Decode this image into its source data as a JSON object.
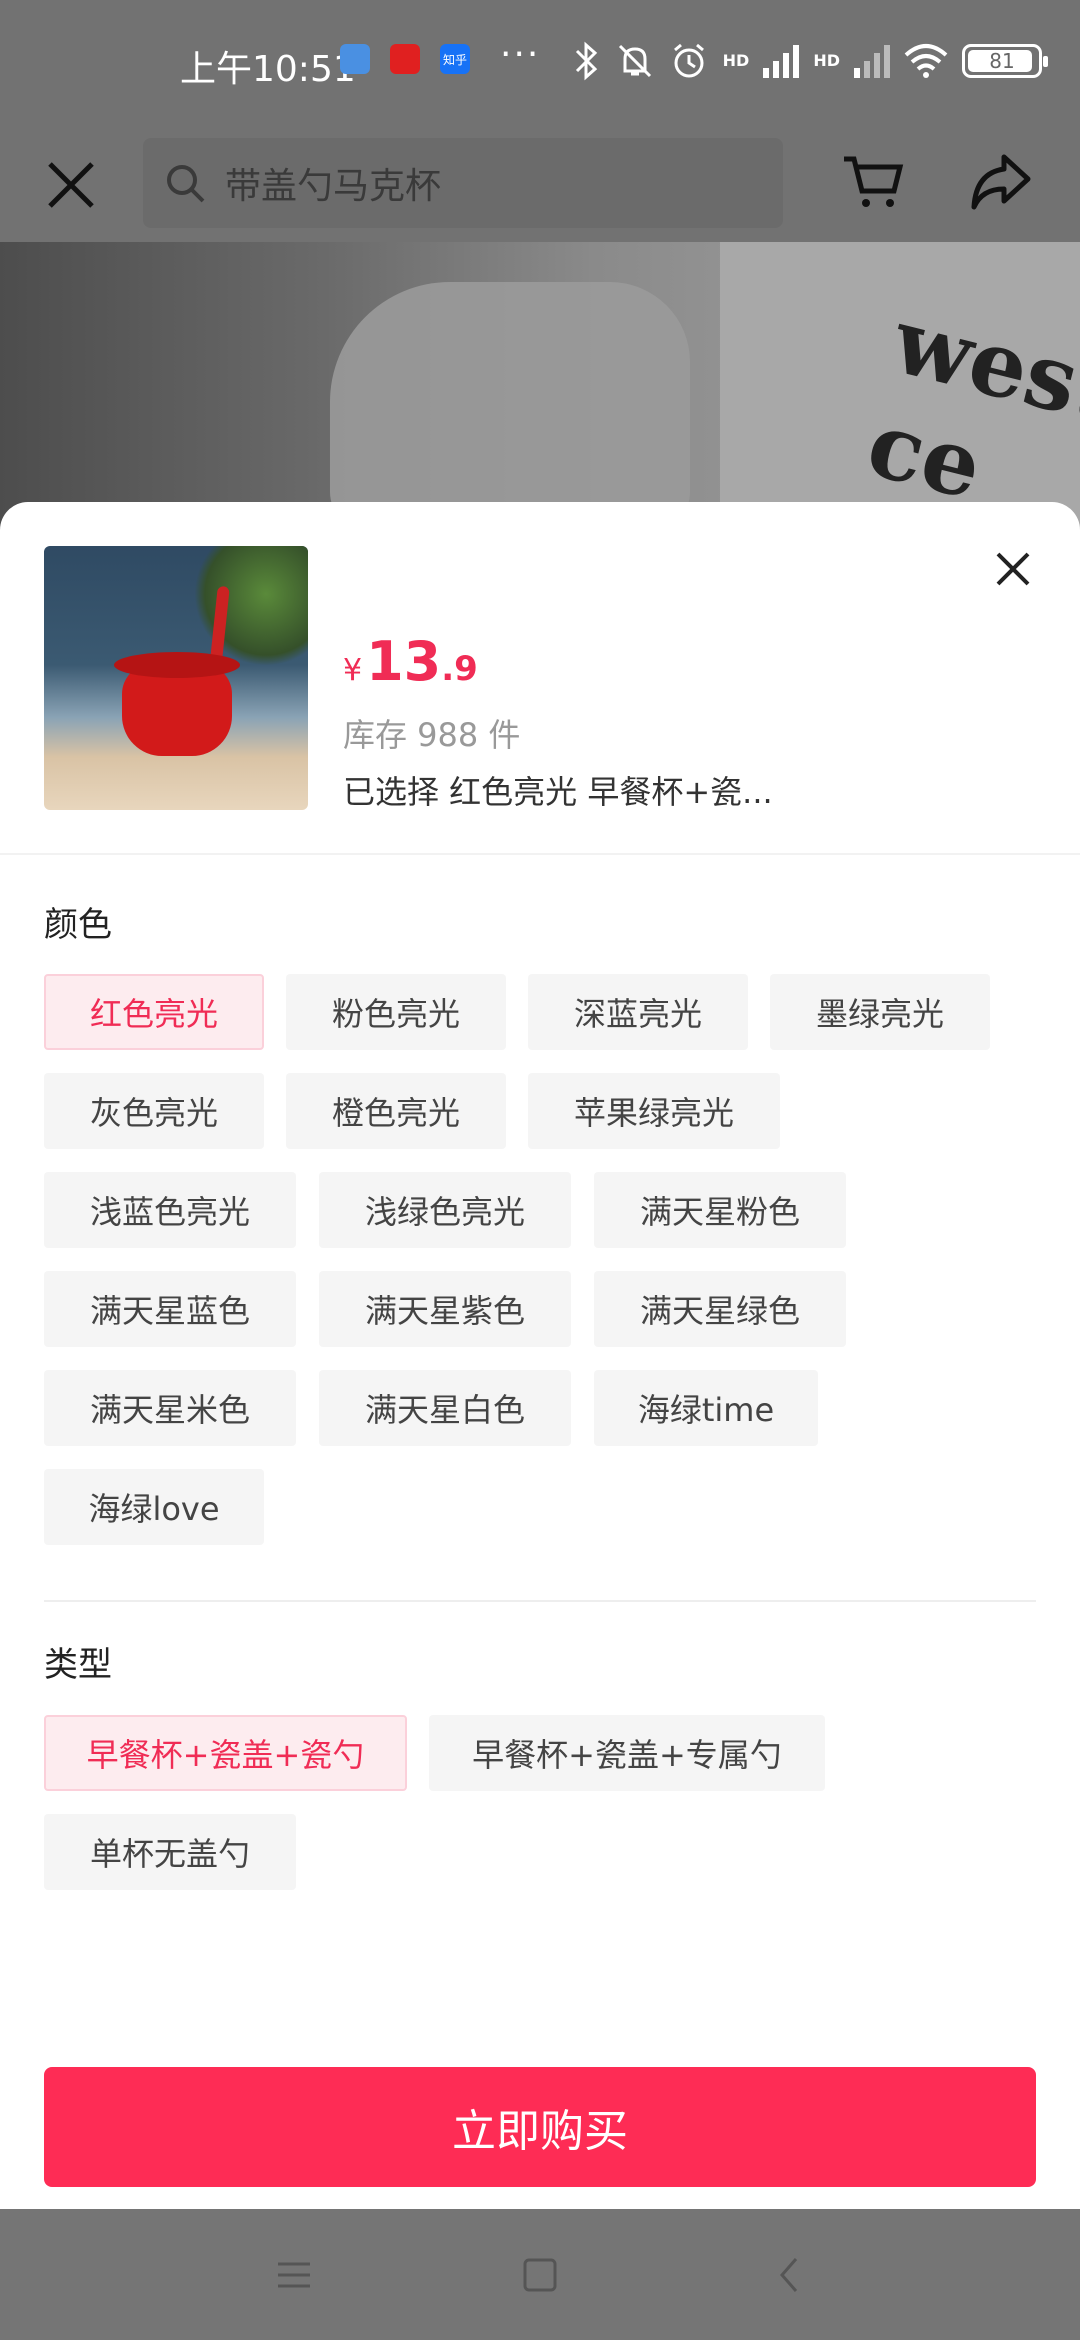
{
  "status": {
    "time": "上午10:51",
    "apps": [
      "百度网盘",
      "京东",
      "知乎"
    ],
    "app_short": [
      "",
      "",
      "知乎"
    ],
    "dots": "···",
    "hd1": "HD",
    "hd2": "HD",
    "battery": "81"
  },
  "search": {
    "placeholder": "带盖勺马克杯"
  },
  "hero": {
    "shirt_text": "west ce"
  },
  "product": {
    "price_symbol": "¥",
    "price_integer": "13",
    "price_decimal": ".9",
    "stock": "库存 988 件",
    "selected": "已选择  红色亮光 早餐杯+瓷..."
  },
  "color_section": {
    "title": "颜色",
    "options": [
      "红色亮光",
      "粉色亮光",
      "深蓝亮光",
      "墨绿亮光",
      "灰色亮光",
      "橙色亮光",
      "苹果绿亮光",
      "浅蓝色亮光",
      "浅绿色亮光",
      "满天星粉色",
      "满天星蓝色",
      "满天星紫色",
      "满天星绿色",
      "满天星米色",
      "满天星白色",
      "海绿time",
      "海绿love"
    ],
    "selected_index": 0
  },
  "type_section": {
    "title": "类型",
    "options": [
      "早餐杯+瓷盖+瓷勺",
      "早餐杯+瓷盖+专属勺",
      "单杯无盖勺"
    ],
    "selected_index": 0
  },
  "buy_button": "立即购买",
  "colors": {
    "accent": "#fe2c55",
    "price": "#f02c55",
    "chip_bg": "#f5f5f5",
    "chip_active_bg": "#fdecef"
  }
}
